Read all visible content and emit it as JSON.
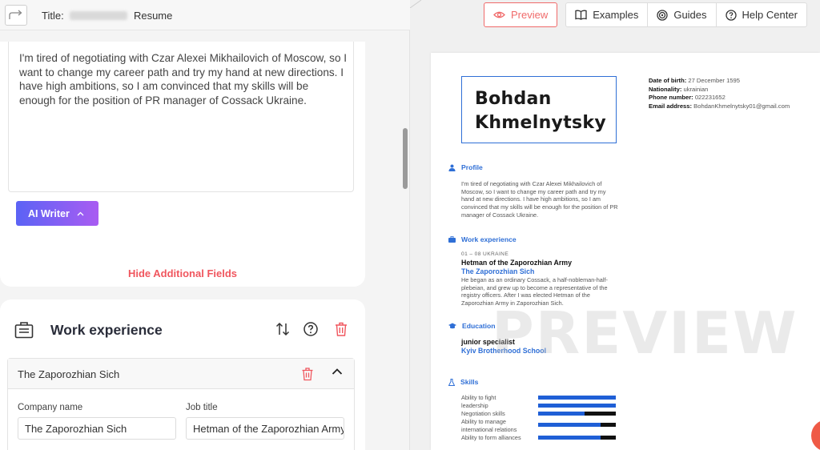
{
  "editor": {
    "title_prefix": "Title:",
    "title_suffix": "Resume",
    "summary_text": "I'm tired of negotiating with Czar Alexei Mikhailovich of Moscow, so I want to change my career path and try my hand at new directions. I have high ambitions, so I am convinced that my skills will be enough for the position of PR manager of Cossack Ukraine.",
    "ai_writer_label": "AI Writer",
    "hide_fields_label": "Hide Additional Fields",
    "work_section_title": "Work experience",
    "entry_title": "The Zaporozhian Sich",
    "company_label": "Company name",
    "company_value": "The Zaporozhian Sich",
    "job_label": "Job title",
    "job_value": "Hetman of the Zaporozhian Army"
  },
  "nav": {
    "preview": "Preview",
    "examples": "Examples",
    "guides": "Guides",
    "help": "Help Center"
  },
  "resume": {
    "first_name": "Bohdan",
    "last_name": "Khmelnytsky",
    "personal": {
      "dob_label": "Date of birth:",
      "dob": "27 December 1595",
      "nat_label": "Nationality:",
      "nat": "ukrainian",
      "phone_label": "Phone number:",
      "phone": "022231652",
      "email_label": "Email address:",
      "email": "BohdanKhmelnytsky01@gmail.com"
    },
    "profile_heading": "Profile",
    "profile_text": "I'm tired of negotiating with Czar Alexei Mikhailovich of Moscow, so I want to change my career path and try my hand at new directions. I have high ambitions, so I am convinced that my skills will be enough for the position of PR manager of Cossack Ukraine.",
    "work_heading": "Work experience",
    "job_date": "01 – 08     UKRAINE",
    "job_title": "Hetman of the Zaporozhian Army",
    "job_company": "The Zaporozhian Sich",
    "job_desc": "He began as an ordinary Cossack, a half-nobleman-half-plebeian, and grew up to become a representative of the registry officers. After I was elected Hetman of the Zaporozhian Army in Zaporozhian Sich.",
    "edu_heading": "Education",
    "edu_degree": "junior specialist",
    "edu_school": "Kyiv Brotherhood School",
    "skills_heading": "Skills",
    "skills": [
      {
        "name": "Ability to fight",
        "level": 1.0
      },
      {
        "name": "leadership",
        "level": 1.0
      },
      {
        "name": "Negotiation skills",
        "level": 0.6
      },
      {
        "name": "Ability to manage international relations",
        "level": 0.8
      },
      {
        "name": "Ability to form alliances",
        "level": 0.8
      }
    ],
    "watermark": "PREVIEW"
  },
  "colors": {
    "accent_blue": "#2f6fd6",
    "danger_red": "#f0565e",
    "ai_gradient_start": "#5b63f5",
    "ai_gradient_end": "#a95cf2"
  }
}
